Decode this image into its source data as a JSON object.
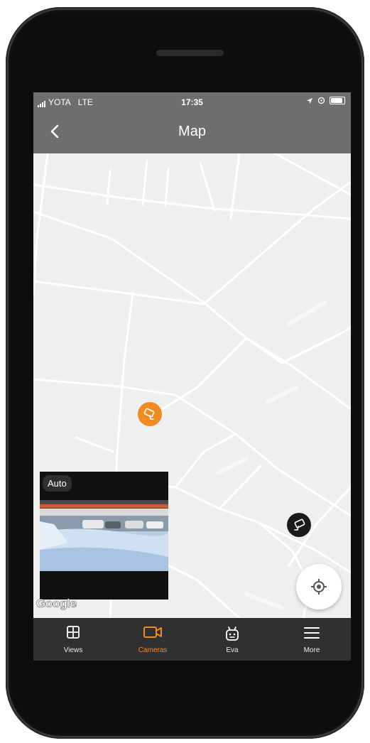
{
  "status_bar": {
    "carrier": "YOTA",
    "network": "LTE",
    "time": "17:35"
  },
  "nav": {
    "title": "Map",
    "back_icon": "chevron-left-icon"
  },
  "map": {
    "preview": {
      "label": "Auto"
    },
    "attribution": "Google",
    "markers": [
      {
        "name": "camera-marker-active",
        "color": "#f08a24"
      },
      {
        "name": "camera-marker",
        "color": "#1b1b1b"
      }
    ],
    "locate_icon": "crosshair-icon"
  },
  "tabs": [
    {
      "label": "Views",
      "icon": "grid-icon",
      "active": false
    },
    {
      "label": "Cameras",
      "icon": "camera-icon",
      "active": true
    },
    {
      "label": "Eva",
      "icon": "robot-icon",
      "active": false
    },
    {
      "label": "More",
      "icon": "menu-icon",
      "active": false
    }
  ],
  "colors": {
    "accent": "#f08a24",
    "bars": "#6e6e6e",
    "tabbar": "#303030",
    "map_bg": "#efefef"
  }
}
